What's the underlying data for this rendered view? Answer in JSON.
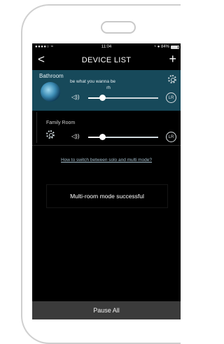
{
  "status_bar": {
    "signal": "●●●●○",
    "wifi": "≈",
    "time": "11:04",
    "right": "◔ ● 84%"
  },
  "nav": {
    "back_label": "<",
    "title": "DEVICE LIST",
    "add_label": "+"
  },
  "rooms": {
    "bathroom": {
      "name": "Bathroom",
      "track_line1": "be what you wanna be",
      "track_line2": "rh",
      "lr_label": "LR",
      "volume": 0.2
    },
    "family": {
      "name": "Family Room",
      "lr_label": "LR",
      "volume": 0.2
    }
  },
  "help_link_text": "How to switch between solo and multi mode?",
  "toast_message": "Multi-room mode successful",
  "pause_all_label": "Pause All",
  "colors": {
    "bathroom_card": "#17495a",
    "screen_bg": "#000000",
    "pause_bar": "#3b3b3b",
    "link": "#a8c2d0"
  }
}
